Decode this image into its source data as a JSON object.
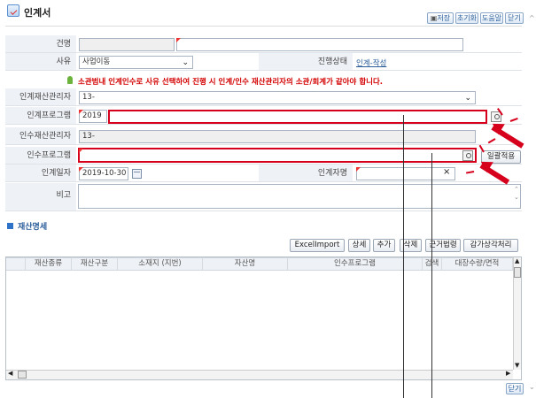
{
  "header": {
    "title": "인계서",
    "buttons": [
      "저장",
      "초기화",
      "도움말",
      "닫기"
    ]
  },
  "form": {
    "subject_label": "건명",
    "subject_value": "",
    "reason_label": "사유",
    "reason_value": "사업이동",
    "status_label": "진행상태",
    "status_value": "인계-작성",
    "warning": "소관범내 인계인수로 사유 선택하여 진행 시 인계/인수 재산관리자의 소관/회계가 같아야 합니다.",
    "from_manager_label": "인계재산관리자",
    "from_manager_value": "13-",
    "from_program_label": "인계프로그램",
    "from_program_value": "2019",
    "to_manager_label": "인수재산관리자",
    "to_manager_value": "13-",
    "to_program_label": "인수프로그램",
    "to_program_value": "",
    "bulk_apply_label": "일괄적용",
    "date_label": "인계일자",
    "date_value": "2019-10-30",
    "handler_label": "인계자명",
    "handler_value": "",
    "clear_glyph": "×",
    "remark_label": "비고",
    "remark_value": ""
  },
  "details": {
    "section_title": "재산명세",
    "actions": [
      "ExcelImport",
      "상세",
      "추가",
      "삭제",
      "근거법령",
      "감가상각처리"
    ],
    "columns": [
      "재산종류",
      "재산구분",
      "소재지 (지번)",
      "자산명",
      "인수프로그램",
      "검색",
      "대장수량/면적"
    ],
    "footer_close": "닫기"
  },
  "colors": {
    "accent": "#2a5d9a",
    "highlight_red": "#d6001c",
    "warning_red": "#d40000",
    "label_bg": "#eef1f5"
  },
  "icons": [
    "title-icon",
    "search-icon",
    "calendar-icon",
    "section-icon",
    "chevron-down-icon"
  ]
}
